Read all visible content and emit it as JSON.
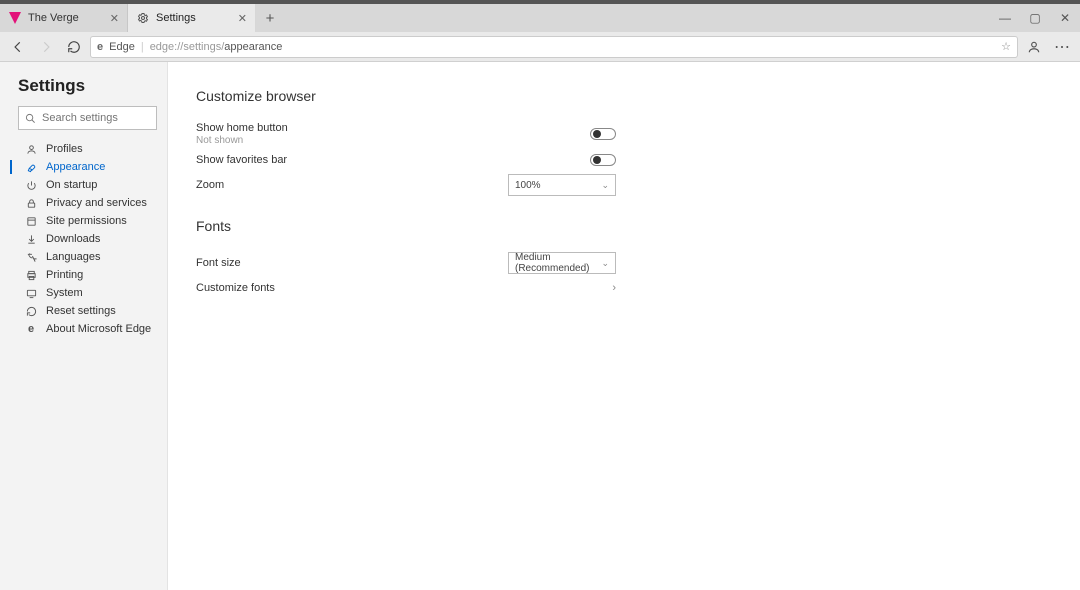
{
  "tabs": [
    {
      "title": "The Verge",
      "favicon": "verge"
    },
    {
      "title": "Settings",
      "favicon": "gear"
    }
  ],
  "addressbar": {
    "label": "Edge",
    "url_prefix": "edge://settings/",
    "url_suffix": "appearance"
  },
  "sidebar": {
    "title": "Settings",
    "search_placeholder": "Search settings",
    "items": [
      {
        "label": "Profiles",
        "icon": "person"
      },
      {
        "label": "Appearance",
        "icon": "brush",
        "active": true
      },
      {
        "label": "On startup",
        "icon": "power"
      },
      {
        "label": "Privacy and services",
        "icon": "lock"
      },
      {
        "label": "Site permissions",
        "icon": "site"
      },
      {
        "label": "Downloads",
        "icon": "download"
      },
      {
        "label": "Languages",
        "icon": "lang"
      },
      {
        "label": "Printing",
        "icon": "printer"
      },
      {
        "label": "System",
        "icon": "system"
      },
      {
        "label": "Reset settings",
        "icon": "reset"
      },
      {
        "label": "About Microsoft Edge",
        "icon": "edge"
      }
    ]
  },
  "content": {
    "section1_title": "Customize browser",
    "home_button": {
      "label": "Show home button",
      "sub": "Not shown",
      "state": "off"
    },
    "favorites_bar": {
      "label": "Show favorites bar",
      "state": "off"
    },
    "zoom": {
      "label": "Zoom",
      "value": "100%"
    },
    "section2_title": "Fonts",
    "font_size": {
      "label": "Font size",
      "value": "Medium (Recommended)"
    },
    "customize_fonts": {
      "label": "Customize fonts"
    }
  }
}
